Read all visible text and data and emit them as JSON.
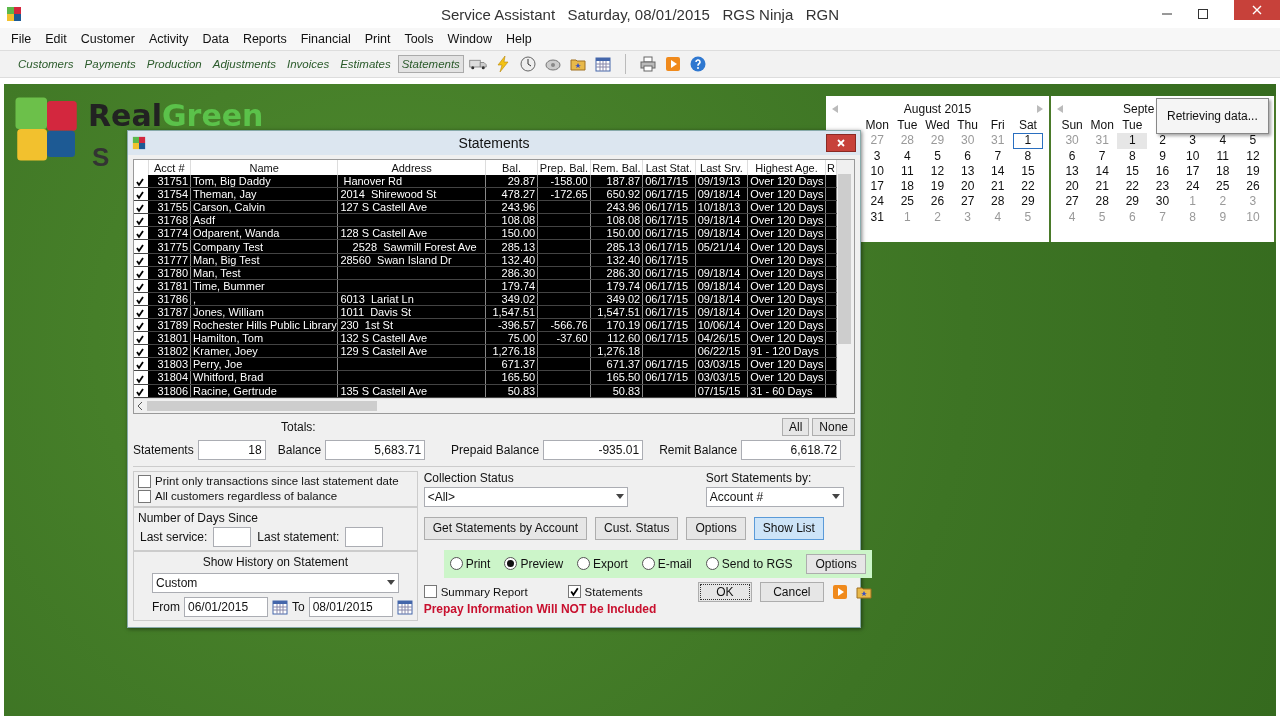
{
  "window": {
    "title": "Service Assistant   Saturday, 08/01/2015   RGS Ninja   RGN"
  },
  "menu": [
    "File",
    "Edit",
    "Customer",
    "Activity",
    "Data",
    "Reports",
    "Financial",
    "Print",
    "Tools",
    "Window",
    "Help"
  ],
  "toolbar": [
    {
      "label": "Customers",
      "selected": false
    },
    {
      "label": "Payments",
      "selected": false
    },
    {
      "label": "Production",
      "selected": false
    },
    {
      "label": "Adjustments",
      "selected": false
    },
    {
      "label": "Invoices",
      "selected": false
    },
    {
      "label": "Estimates",
      "selected": false
    },
    {
      "label": "Statements",
      "selected": true
    }
  ],
  "logo": {
    "words": [
      "Real",
      "Green"
    ],
    "subtitle": "S"
  },
  "calendars": [
    {
      "title": "August 2015",
      "weekdays": [
        "Mon",
        "Tue",
        "Wed",
        "Thu",
        "Fri",
        "Sat"
      ],
      "weeks": [
        [
          {
            "d": "27",
            "other": true,
            "selected": false
          },
          {
            "d": "28",
            "other": true,
            "selected": false
          },
          {
            "d": "29",
            "other": true,
            "selected": false
          },
          {
            "d": "30",
            "other": true,
            "selected": false
          },
          {
            "d": "31",
            "other": true,
            "selected": false
          },
          {
            "d": "1",
            "other": false,
            "selected": true
          }
        ],
        [
          {
            "d": "3",
            "other": false,
            "selected": false
          },
          {
            "d": "4",
            "other": false,
            "selected": false
          },
          {
            "d": "5",
            "other": false,
            "selected": false
          },
          {
            "d": "6",
            "other": false,
            "selected": false
          },
          {
            "d": "7",
            "other": false,
            "selected": false
          },
          {
            "d": "8",
            "other": false,
            "selected": false
          }
        ],
        [
          {
            "d": "10",
            "other": false,
            "selected": false
          },
          {
            "d": "11",
            "other": false,
            "selected": false
          },
          {
            "d": "12",
            "other": false,
            "selected": false
          },
          {
            "d": "13",
            "other": false,
            "selected": false
          },
          {
            "d": "14",
            "other": false,
            "selected": false
          },
          {
            "d": "15",
            "other": false,
            "selected": false
          }
        ],
        [
          {
            "d": "17",
            "other": false,
            "selected": false
          },
          {
            "d": "18",
            "other": false,
            "selected": false
          },
          {
            "d": "19",
            "other": false,
            "selected": false
          },
          {
            "d": "20",
            "other": false,
            "selected": false
          },
          {
            "d": "21",
            "other": false,
            "selected": false
          },
          {
            "d": "22",
            "other": false,
            "selected": false
          }
        ],
        [
          {
            "d": "24",
            "other": false,
            "selected": false
          },
          {
            "d": "25",
            "other": false,
            "selected": false
          },
          {
            "d": "26",
            "other": false,
            "selected": false
          },
          {
            "d": "27",
            "other": false,
            "selected": false
          },
          {
            "d": "28",
            "other": false,
            "selected": false
          },
          {
            "d": "29",
            "other": false,
            "selected": false
          }
        ],
        [
          {
            "d": "31",
            "other": false,
            "selected": false
          },
          {
            "d": "1",
            "other": true,
            "selected": false
          },
          {
            "d": "2",
            "other": true,
            "selected": false
          },
          {
            "d": "3",
            "other": true,
            "selected": false
          },
          {
            "d": "4",
            "other": true,
            "selected": false
          },
          {
            "d": "5",
            "other": true,
            "selected": false
          }
        ]
      ]
    },
    {
      "title": "Septe",
      "weekdays": [
        "Sun",
        "Mon",
        "Tue"
      ],
      "weeks": [
        [
          {
            "d": "30",
            "other": true,
            "selected": false
          },
          {
            "d": "31",
            "other": true,
            "selected": false
          },
          {
            "d": "1",
            "other": false,
            "selected": true
          },
          {
            "d": "2",
            "other": false,
            "selected": false
          },
          {
            "d": "3",
            "other": false,
            "selected": false
          },
          {
            "d": "4",
            "other": false,
            "selected": false
          },
          {
            "d": "5",
            "other": false,
            "selected": false
          }
        ],
        [
          {
            "d": "6",
            "other": false,
            "selected": false
          },
          {
            "d": "7",
            "other": false,
            "selected": false
          },
          {
            "d": "8",
            "other": false,
            "selected": false
          },
          {
            "d": "9",
            "other": false,
            "selected": false
          },
          {
            "d": "10",
            "other": false,
            "selected": false
          },
          {
            "d": "11",
            "other": false,
            "selected": false
          },
          {
            "d": "12",
            "other": false,
            "selected": false
          }
        ],
        [
          {
            "d": "13",
            "other": false,
            "selected": false
          },
          {
            "d": "14",
            "other": false,
            "selected": false
          },
          {
            "d": "15",
            "other": false,
            "selected": false
          },
          {
            "d": "16",
            "other": false,
            "selected": false
          },
          {
            "d": "17",
            "other": false,
            "selected": false
          },
          {
            "d": "18",
            "other": false,
            "selected": false
          },
          {
            "d": "19",
            "other": false,
            "selected": false
          }
        ],
        [
          {
            "d": "20",
            "other": false,
            "selected": false
          },
          {
            "d": "21",
            "other": false,
            "selected": false
          },
          {
            "d": "22",
            "other": false,
            "selected": false
          },
          {
            "d": "23",
            "other": false,
            "selected": false
          },
          {
            "d": "24",
            "other": false,
            "selected": false
          },
          {
            "d": "25",
            "other": false,
            "selected": false
          },
          {
            "d": "26",
            "other": false,
            "selected": false
          }
        ],
        [
          {
            "d": "27",
            "other": false,
            "selected": false
          },
          {
            "d": "28",
            "other": false,
            "selected": false
          },
          {
            "d": "29",
            "other": false,
            "selected": false
          },
          {
            "d": "30",
            "other": false,
            "selected": false
          },
          {
            "d": "1",
            "other": true,
            "selected": false
          },
          {
            "d": "2",
            "other": true,
            "selected": false
          },
          {
            "d": "3",
            "other": true,
            "selected": false
          }
        ],
        [
          {
            "d": "4",
            "other": true,
            "selected": false
          },
          {
            "d": "5",
            "other": true,
            "selected": false
          },
          {
            "d": "6",
            "other": true,
            "selected": false
          },
          {
            "d": "7",
            "other": true,
            "selected": false
          },
          {
            "d": "8",
            "other": true,
            "selected": false
          },
          {
            "d": "9",
            "other": true,
            "selected": false
          },
          {
            "d": "10",
            "other": true,
            "selected": false
          }
        ]
      ]
    }
  ],
  "tooltip": "Retrieving data...",
  "dialog": {
    "title": "Statements",
    "table": {
      "columns": [
        "Acct #",
        "Name",
        "Address",
        "Bal.",
        "Prep. Bal.",
        "Rem. Bal.",
        "Last Stat.",
        "Last Srv.",
        "Highest Age.",
        "R"
      ],
      "rows": [
        {
          "checked": true,
          "acct": "31751",
          "name": "Tom, Big Daddy",
          "address": " Hanover Rd",
          "bal": "29.87",
          "prep": "-158.00",
          "rem": "187.87",
          "last_stat": "06/17/15",
          "last_srv": "09/19/13",
          "age": "Over 120 Days"
        },
        {
          "checked": true,
          "acct": "31754",
          "name": "Theman, Jay",
          "address": "2014  Shirewood St",
          "bal": "478.27",
          "prep": "-172.65",
          "rem": "650.92",
          "last_stat": "06/17/15",
          "last_srv": "09/18/14",
          "age": "Over 120 Days"
        },
        {
          "checked": true,
          "acct": "31755",
          "name": "Carson, Calvin",
          "address": "127 S Castell Ave",
          "bal": "243.96",
          "rem": "243.96",
          "last_stat": "06/17/15",
          "last_srv": "10/18/13",
          "age": "Over 120 Days"
        },
        {
          "checked": true,
          "acct": "31768",
          "name": "Asdf",
          "bal": "108.08",
          "rem": "108.08",
          "last_stat": "06/17/15",
          "last_srv": "09/18/14",
          "age": "Over 120 Days"
        },
        {
          "checked": true,
          "acct": "31774",
          "name": "Odparent, Wanda",
          "address": "128 S Castell Ave",
          "bal": "150.00",
          "rem": "150.00",
          "last_stat": "06/17/15",
          "last_srv": "09/18/14",
          "age": "Over 120 Days"
        },
        {
          "checked": true,
          "acct": "31775",
          "name": "Company Test",
          "address": "    2528  Sawmill Forest Ave",
          "bal": "285.13",
          "rem": "285.13",
          "last_stat": "06/17/15",
          "last_srv": "05/21/14",
          "age": "Over 120 Days"
        },
        {
          "checked": true,
          "acct": "31777",
          "name": "Man, Big Test",
          "address": "28560  Swan Island Dr",
          "bal": "132.40",
          "rem": "132.40",
          "last_stat": "06/17/15",
          "age": "Over 120 Days"
        },
        {
          "checked": true,
          "acct": "31780",
          "name": "Man, Test",
          "bal": "286.30",
          "rem": "286.30",
          "last_stat": "06/17/15",
          "last_srv": "09/18/14",
          "age": "Over 120 Days"
        },
        {
          "checked": true,
          "acct": "31781",
          "name": "Time, Bummer",
          "bal": "179.74",
          "rem": "179.74",
          "last_stat": "06/17/15",
          "last_srv": "09/18/14",
          "age": "Over 120 Days"
        },
        {
          "checked": true,
          "acct": "31786",
          "name": ",",
          "address": "6013  Lariat Ln",
          "bal": "349.02",
          "rem": "349.02",
          "last_stat": "06/17/15",
          "last_srv": "09/18/14",
          "age": "Over 120 Days"
        },
        {
          "checked": true,
          "acct": "31787",
          "name": "Jones, William",
          "address": "1011  Davis St",
          "bal": "1,547.51",
          "rem": "1,547.51",
          "last_stat": "06/17/15",
          "last_srv": "09/18/14",
          "age": "Over 120 Days"
        },
        {
          "checked": true,
          "acct": "31789",
          "name": "Rochester Hills Public Library",
          "address": "230  1st St",
          "bal": "-396.57",
          "prep": "-566.76",
          "rem": "170.19",
          "last_stat": "06/17/15",
          "last_srv": "10/06/14",
          "age": "Over 120 Days"
        },
        {
          "checked": true,
          "acct": "31801",
          "name": "Hamilton, Tom",
          "address": "132 S Castell Ave",
          "bal": "75.00",
          "prep": "-37.60",
          "rem": "112.60",
          "last_stat": "06/17/15",
          "last_srv": "04/26/15",
          "age": "Over 120 Days"
        },
        {
          "checked": true,
          "acct": "31802",
          "name": "Kramer, Joey",
          "address": "129 S Castell Ave",
          "bal": "1,276.18",
          "rem": "1,276.18",
          "last_srv": "06/22/15",
          "age": "91 - 120 Days"
        },
        {
          "checked": true,
          "acct": "31803",
          "name": "Perry, Joe",
          "bal": "671.37",
          "rem": "671.37",
          "last_stat": "06/17/15",
          "last_srv": "03/03/15",
          "age": "Over 120 Days"
        },
        {
          "checked": true,
          "acct": "31804",
          "name": "Whitford, Brad",
          "bal": "165.50",
          "rem": "165.50",
          "last_stat": "06/17/15",
          "last_srv": "03/03/15",
          "age": "Over 120 Days"
        },
        {
          "checked": true,
          "acct": "31806",
          "name": "Racine, Gertrude",
          "address": "135 S Castell Ave",
          "bal": "50.83",
          "rem": "50.83",
          "last_srv": "07/15/15",
          "age": "31 - 60 Days"
        }
      ]
    },
    "select_buttons": [
      "All",
      "None"
    ],
    "totals_label": "Totals:",
    "totals": [
      {
        "label": "Statements",
        "value": "18"
      },
      {
        "label": "Balance",
        "value": "5,683.71"
      },
      {
        "label": "Prepaid Balance",
        "value": "-935.01"
      },
      {
        "label": "Remit Balance",
        "value": "6,618.72"
      }
    ],
    "filters": [
      {
        "label": "Print only transactions since last statement date",
        "checked": false
      },
      {
        "label": "All customers regardless of balance",
        "checked": false
      }
    ],
    "days_since": {
      "title": "Number of Days Since",
      "fields": [
        {
          "label": "Last service:"
        },
        {
          "label": "Last statement:"
        }
      ]
    },
    "history": {
      "title": "Show History on Statement",
      "value": "Custom",
      "from_label": "From",
      "from": "06/01/2015",
      "to_label": "To",
      "to": "08/01/2015"
    },
    "collection_status": {
      "label": "Collection Status",
      "value": "<All>"
    },
    "sort_by": {
      "label": "Sort Statements by:",
      "value": "Account #"
    },
    "action_buttons": [
      {
        "label": "Get Statements by Account",
        "selected": false
      },
      {
        "label": "Cust. Status",
        "selected": false
      },
      {
        "label": "Options",
        "selected": false
      },
      {
        "label": "Show List",
        "selected": true
      }
    ],
    "output": [
      {
        "label": "Print",
        "selected": false
      },
      {
        "label": "Preview",
        "selected": true
      },
      {
        "label": "Export",
        "selected": false
      },
      {
        "label": "E-mail",
        "selected": false
      },
      {
        "label": "Send to RGS",
        "selected": false
      }
    ],
    "output_options": "Options",
    "include": [
      {
        "label": "Summary Report",
        "checked": false
      },
      {
        "label": "Statements",
        "checked": true
      }
    ],
    "ok": "OK",
    "cancel": "Cancel",
    "warning": "Prepay Information Will NOT be Included"
  }
}
